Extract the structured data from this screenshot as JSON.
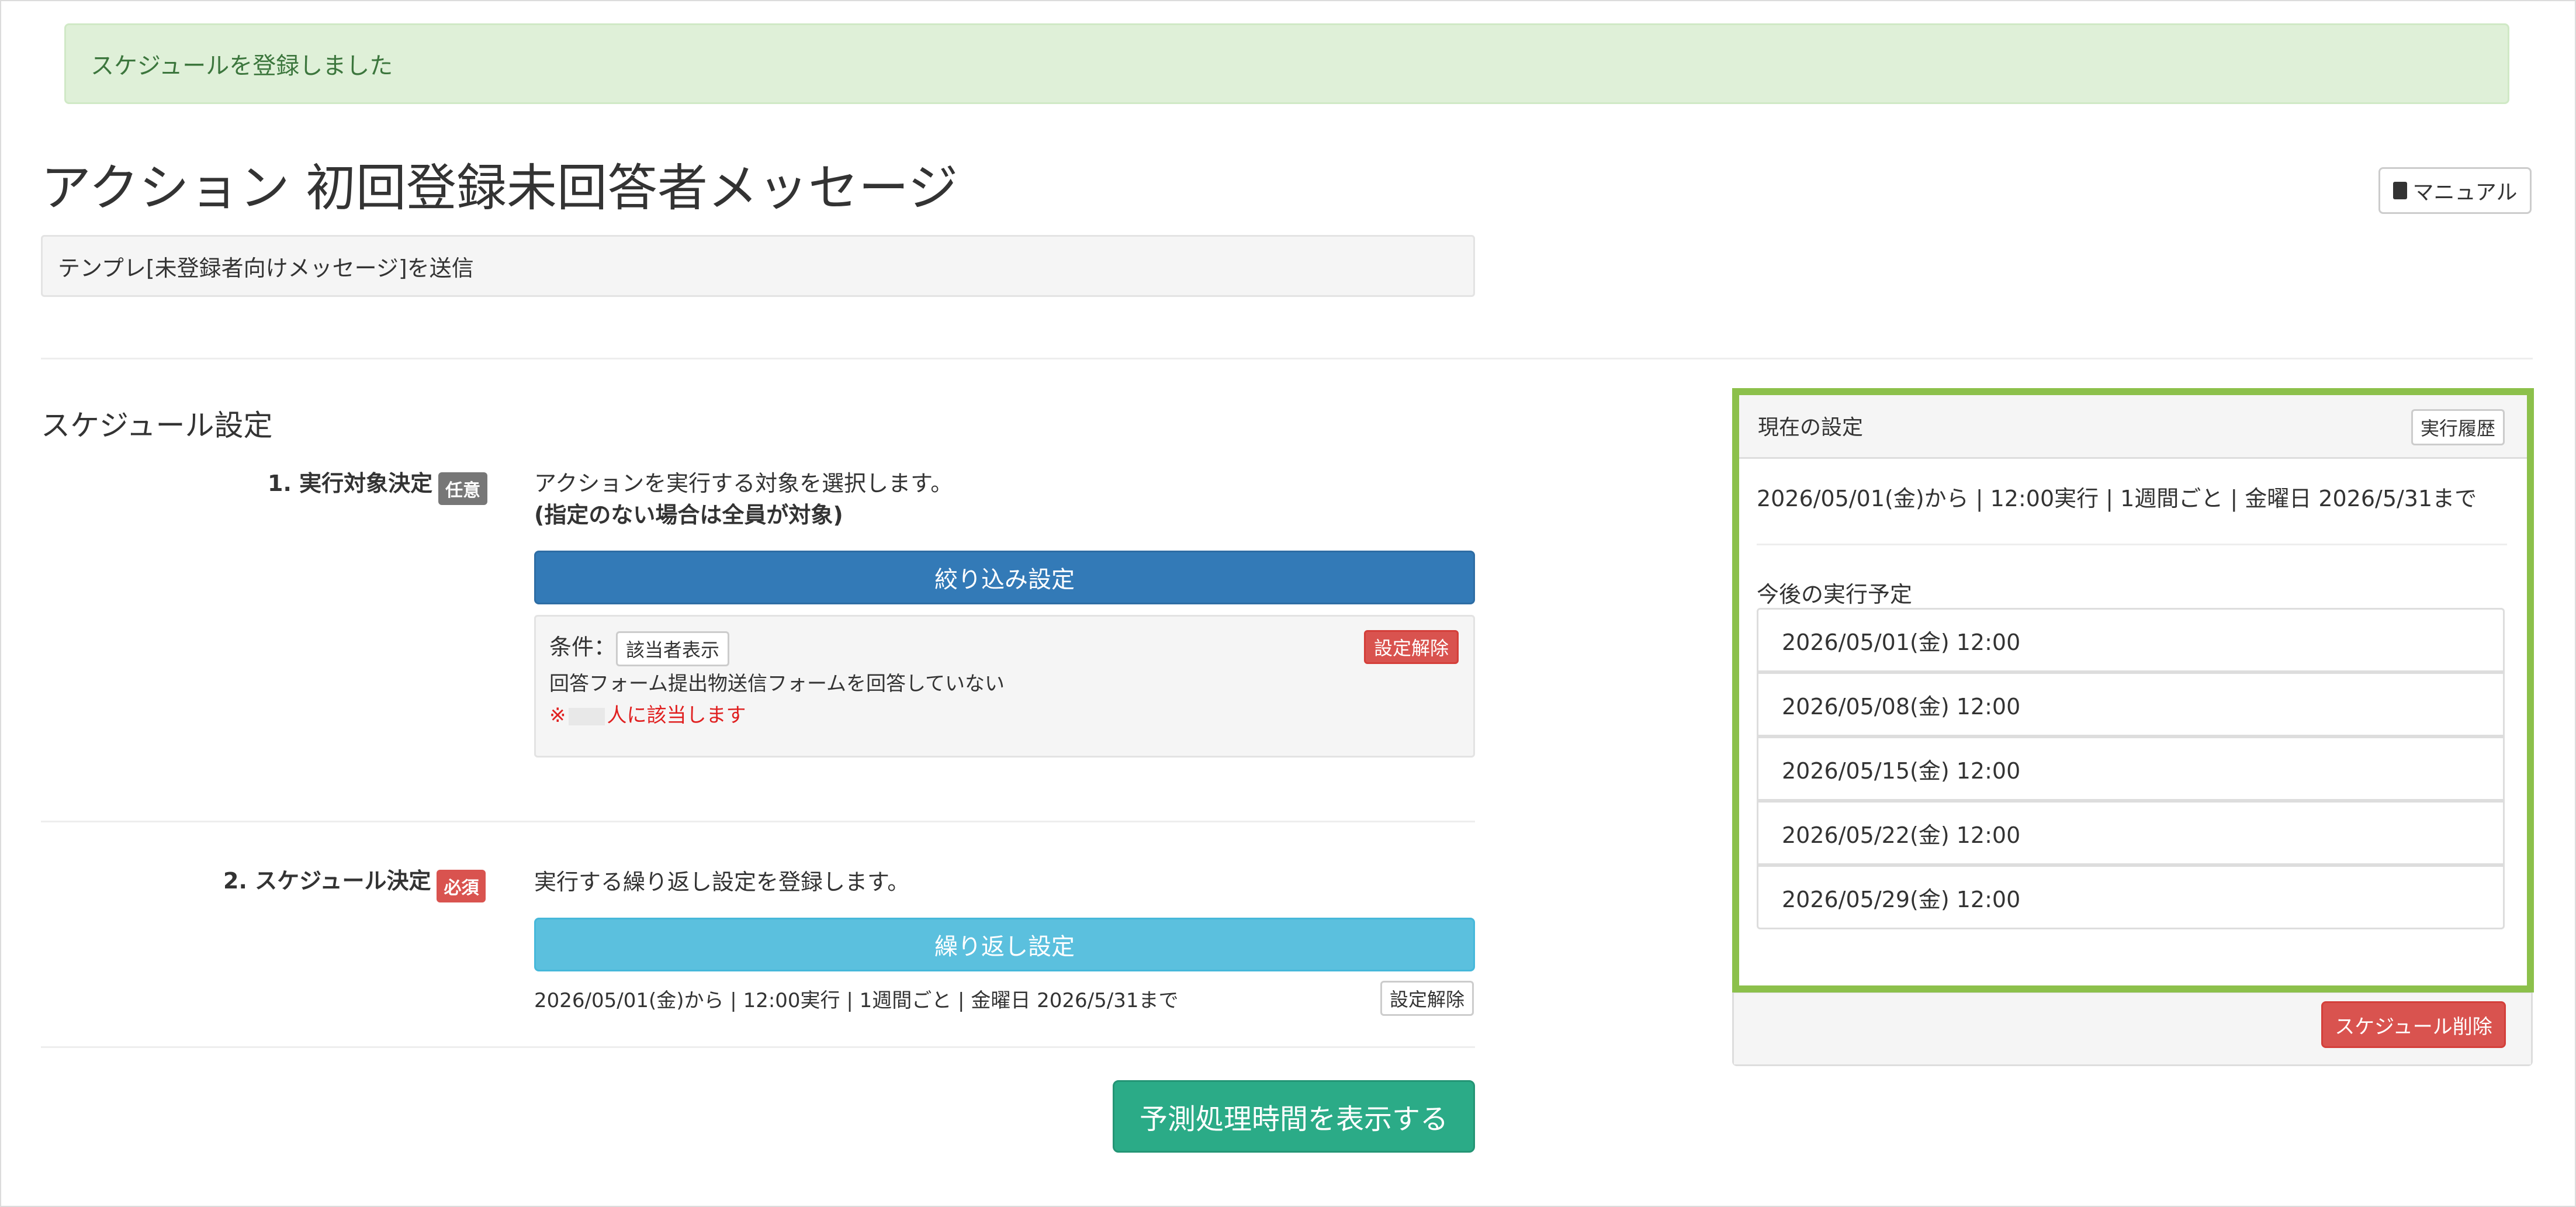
{
  "alert": {
    "message": "スケジュールを登録しました"
  },
  "header": {
    "title": "アクション 初回登録未回答者メッセージ",
    "manual_label": "マニュアル",
    "description": "テンプレ[未登録者向けメッセージ]を送信"
  },
  "schedule": {
    "heading": "スケジュール設定",
    "step1": {
      "label": "1. 実行対象決定",
      "badge": "任意",
      "desc1": "アクションを実行する対象を選択します。",
      "desc2": "(指定のない場合は全員が対象)",
      "button": "絞り込み設定",
      "condition_label": "条件：",
      "condition_show": "該当者表示",
      "condition_text": "回答フォーム提出物送信フォームを回答していない",
      "count_prefix": "※",
      "count_suffix": "人に該当します",
      "clear": "設定解除"
    },
    "step2": {
      "label": "2. スケジュール決定",
      "badge": "必須",
      "desc": "実行する繰り返し設定を登録します。",
      "button": "繰り返し設定",
      "summary": "2026/05/01(金)から | 12:00実行 | 1週間ごと | 金曜日 2026/5/31まで",
      "clear": "設定解除"
    },
    "predict_button": "予測処理時間を表示する"
  },
  "panel": {
    "title": "現在の設定",
    "history_button": "実行履歴",
    "summary": "2026/05/01(金)から | 12:00実行 | 1週間ごと | 金曜日 2026/5/31まで",
    "upcoming_label": "今後の実行予定",
    "upcoming": [
      "2026/05/01(金) 12:00",
      "2026/05/08(金) 12:00",
      "2026/05/15(金) 12:00",
      "2026/05/22(金) 12:00",
      "2026/05/29(金) 12:00"
    ],
    "delete_button": "スケジュール削除"
  },
  "colors": {
    "highlight": "#8cc04b",
    "primary": "#337ab7",
    "info": "#5bc0de",
    "danger": "#d9534f",
    "success_alert_bg": "#dff0d8",
    "teal": "#2bab87"
  },
  "icons": {
    "manual": "book-icon"
  }
}
